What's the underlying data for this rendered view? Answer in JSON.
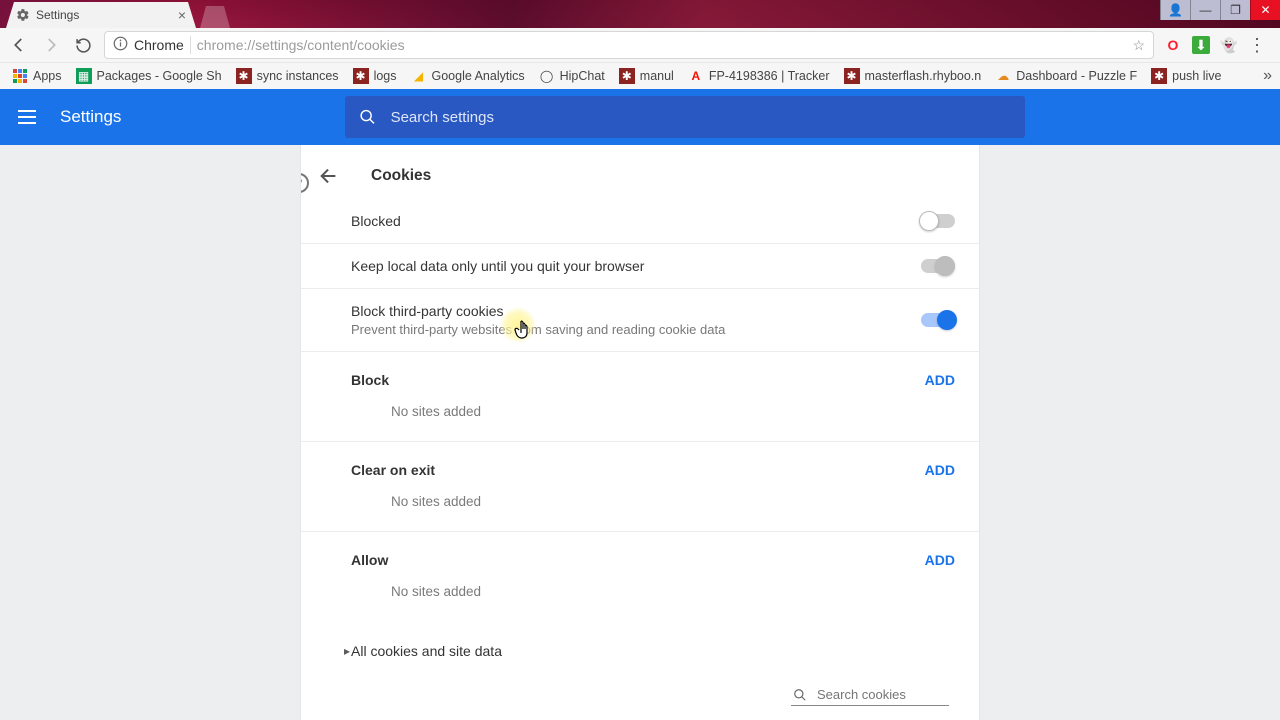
{
  "tab": {
    "title": "Settings"
  },
  "window_controls": {
    "min": "—",
    "max": "❐",
    "user": "👤",
    "close": "✕"
  },
  "omnibox": {
    "scheme": "Chrome",
    "url": "chrome://settings/content/cookies"
  },
  "ext": {
    "opera": "O",
    "idm": "⬇",
    "ghost": "👻",
    "menu": "⋮"
  },
  "bookmarks": {
    "apps": "Apps",
    "items": [
      "Packages - Google Sh",
      "sync instances",
      "logs",
      "Google Analytics",
      "HipChat",
      "manul",
      "FP-4198386 | Tracker",
      "masterflash.rhyboo.n",
      "Dashboard - Puzzle F",
      "push live"
    ],
    "overflow": "»"
  },
  "header": {
    "title": "Settings",
    "search_placeholder": "Search settings"
  },
  "page": {
    "title": "Cookies",
    "rows": {
      "blocked": {
        "label": "Blocked",
        "state": "off"
      },
      "keep_local": {
        "label": "Keep local data only until you quit your browser",
        "state": "neutral"
      },
      "third_party": {
        "label": "Block third-party cookies",
        "sub": "Prevent third-party websites from saving and reading cookie data",
        "state": "on"
      }
    },
    "sections": {
      "block": {
        "title": "Block",
        "add": "ADD",
        "empty": "No sites added"
      },
      "clear": {
        "title": "Clear on exit",
        "add": "ADD",
        "empty": "No sites added"
      },
      "allow": {
        "title": "Allow",
        "add": "ADD",
        "empty": "No sites added"
      }
    },
    "all_cookies": {
      "label": "All cookies and site data",
      "search_placeholder": "Search cookies"
    }
  }
}
